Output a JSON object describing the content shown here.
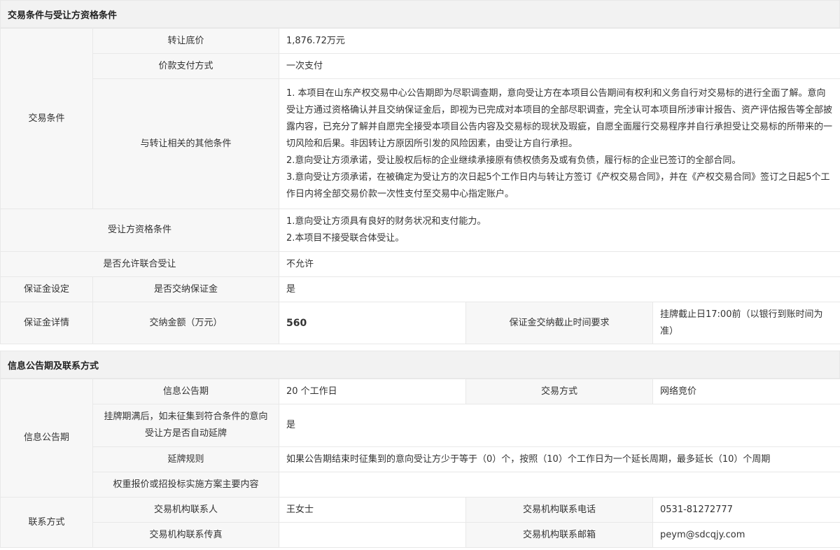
{
  "section1": {
    "title": "交易条件与受让方资格条件",
    "trade_conditions_label": "交易条件",
    "transfer_price_label": "转让底价",
    "transfer_price_value": "1,876.72万元",
    "payment_method_label": "价款支付方式",
    "payment_method_value": "一次支付",
    "other_conditions_label": "与转让相关的其他条件",
    "other_conditions_lines": [
      "1. 本项目在山东产权交易中心公告期即为尽职调查期，意向受让方在本项目公告期间有权利和义务自行对交易标的进行全面了解。意向受让方通过资格确认并且交纳保证金后，即视为已完成对本项目的全部尽职调查，完全认可本项目所涉审计报告、资产评估报告等全部披露内容，已充分了解并自愿完全接受本项目公告内容及交易标的现状及瑕疵，自愿全面履行交易程序并自行承担受让交易标的所带来的一切风险和后果。非因转让方原因所引发的风险因素，由受让方自行承担。",
      "2.意向受让方须承诺，受让股权后标的企业继续承接原有债权债务及或有负债，履行标的企业已签订的全部合同。",
      "3.意向受让方须承诺，在被确定为受让方的次日起5个工作日内与转让方签订《产权交易合同》，并在《产权交易合同》签订之日起5个工作日内将全部交易价款一次性支付至交易中心指定账户。"
    ],
    "qualification_label": "受让方资格条件",
    "qualification_lines": [
      "1.意向受让方须具有良好的财务状况和支付能力。",
      "2.本项目不接受联合体受让。"
    ],
    "joint_label": "是否允许联合受让",
    "joint_value": "不允许",
    "deposit_setting_label": "保证金设定",
    "deposit_required_label": "是否交纳保证金",
    "deposit_required_value": "是",
    "deposit_detail_label": "保证金详情",
    "deposit_amount_label": "交纳金额（万元）",
    "deposit_amount_value": "560",
    "deposit_deadline_label": "保证金交纳截止时间要求",
    "deposit_deadline_value": "挂牌截止日17:00前（以银行到账时间为准）"
  },
  "section2": {
    "title": "信息公告期及联系方式",
    "info_period_group": "信息公告期",
    "info_period_label": "信息公告期",
    "info_period_value": "20 个工作日",
    "trade_mode_label": "交易方式",
    "trade_mode_value": "网络竞价",
    "auto_extend_label": "挂牌期满后，如未征集到符合条件的意向受让方是否自动延牌",
    "auto_extend_value": "是",
    "extend_rule_label": "延牌规则",
    "extend_rule_value": "如果公告期结束时征集到的意向受让方少于等于（0）个，按照（10）个工作日为一个延长周期，最多延长（10）个周期",
    "weighted_label": "权重报价或招投标实施方案主要内容",
    "weighted_value": "",
    "contact_group": "联系方式",
    "contact_person_label": "交易机构联系人",
    "contact_person_value": "王女士",
    "contact_phone_label": "交易机构联系电话",
    "contact_phone_value": "0531-81272777",
    "contact_fax_label": "交易机构联系传真",
    "contact_fax_value": "",
    "contact_email_label": "交易机构联系邮箱",
    "contact_email_value": "peym@sdcqjy.com"
  }
}
